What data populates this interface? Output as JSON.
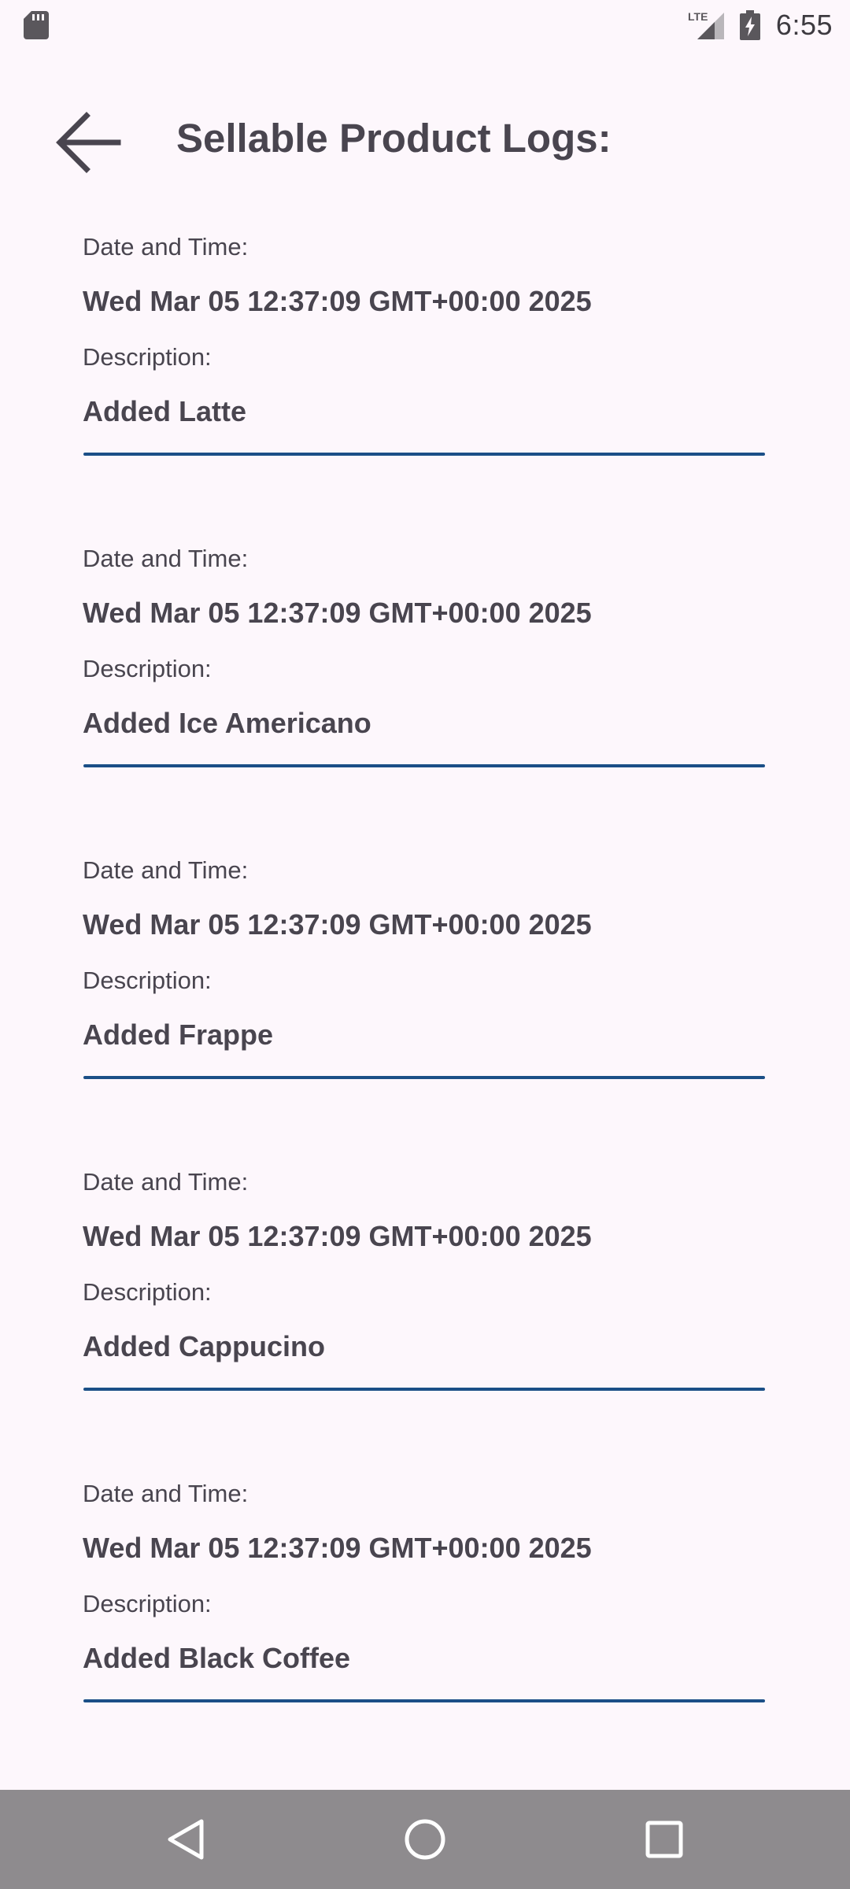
{
  "status_bar": {
    "time": "6:55",
    "network_label": "LTE",
    "icons": [
      "sd-card-icon",
      "lte-signal-icon",
      "battery-charging-icon"
    ]
  },
  "header": {
    "title": "Sellable Product Logs:",
    "back_icon": "arrow-left-icon"
  },
  "logs": [
    {
      "date_label": "Date and Time:",
      "date_value": "Wed Mar 05 12:37:09 GMT+00:00 2025",
      "desc_label": "Description:",
      "desc_value": "Added Latte"
    },
    {
      "date_label": "Date and Time:",
      "date_value": "Wed Mar 05 12:37:09 GMT+00:00 2025",
      "desc_label": "Description:",
      "desc_value": "Added Ice Americano"
    },
    {
      "date_label": "Date and Time:",
      "date_value": "Wed Mar 05 12:37:09 GMT+00:00 2025",
      "desc_label": "Description:",
      "desc_value": "Added Frappe"
    },
    {
      "date_label": "Date and Time:",
      "date_value": "Wed Mar 05 12:37:09 GMT+00:00 2025",
      "desc_label": "Description:",
      "desc_value": "Added Cappucino"
    },
    {
      "date_label": "Date and Time:",
      "date_value": "Wed Mar 05 12:37:09 GMT+00:00 2025",
      "desc_label": "Description:",
      "desc_value": "Added Black Coffee"
    }
  ],
  "nav_bar": {
    "icons": [
      "nav-back-icon",
      "nav-home-icon",
      "nav-recents-icon"
    ]
  },
  "colors": {
    "background": "#fdf7fc",
    "text": "#49454f",
    "divider": "#1b4f87",
    "nav_bar": "#8e8b8e"
  }
}
